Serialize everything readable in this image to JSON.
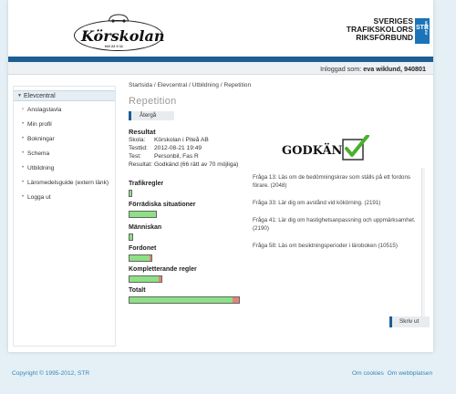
{
  "header": {
    "logo_text": "Körskolan",
    "logo_sub": "fell 22 0 11",
    "logo_icon": "car-icon",
    "str_lines": [
      "SVERIGES",
      "TRAFIKSKOLORS",
      "RIKSFÖRBUND"
    ],
    "str_badge": "STR",
    "str_badge_sub": "MEDLEM"
  },
  "userbar": {
    "label": "Inloggad som:",
    "user": "eva wiklund, 940801"
  },
  "sidebar": {
    "header": "Elevcentral",
    "items": [
      {
        "label": "Anslagstavla",
        "active": true
      },
      {
        "label": "Min profil"
      },
      {
        "label": "Bokningar"
      },
      {
        "label": "Schema"
      },
      {
        "label": "Utbildning"
      },
      {
        "label": "Läromedelsguide (extern länk)"
      },
      {
        "label": "Logga ut"
      }
    ]
  },
  "main": {
    "breadcrumb": "Startsida / Elevcentral / Utbildning / Repetition",
    "title": "Repetition",
    "back_label": "Återgå",
    "result": {
      "heading": "Resultat",
      "rows": [
        {
          "key": "Skola:",
          "value": "Körskolan i Piteå AB"
        },
        {
          "key": "Testtid:",
          "value": "2012-08-21 19:49"
        },
        {
          "key": "Test:",
          "value": "Personbil, Fas R"
        },
        {
          "key": "Resultat:",
          "value": "Godkänd (66 rätt av 70 möjliga)"
        }
      ]
    },
    "verdict": "GODKÄND",
    "verdict_icon": "checkmark-icon",
    "categories": [
      {
        "label": "Trafikregler",
        "correct_frac": 1.0,
        "total_frac": 0.033
      },
      {
        "label": "Förrädiska situationer",
        "correct_frac": 1.0,
        "total_frac": 0.25
      },
      {
        "label": "Människan",
        "correct_frac": 1.0,
        "total_frac": 0.043
      },
      {
        "label": "Fordonet",
        "correct_frac": 0.92,
        "total_frac": 0.212
      },
      {
        "label": "Kompletterande regler",
        "correct_frac": 0.92,
        "total_frac": 0.3
      },
      {
        "label": "Totalt",
        "correct_frac": 0.943,
        "total_frac": 1.0
      }
    ],
    "feedback": [
      "Fråga 13: Läs om de bedömningskrav som ställs på ett fordons förare. (2048)",
      "Fråga 33: Lär dig om avstånd vid kökörning. (2191)",
      "Fråga 41: Lär dig om hastighetsanpassning och uppmärksamhet. (2190)",
      "Fråga 58: Läs om besiktningsperioder i läroboken (10515)"
    ],
    "print_label": "Skriv ut"
  },
  "footer": {
    "copyright": "Copyright © 1995-2012, STR",
    "links": [
      "Om cookies",
      "Om webbplatsen"
    ]
  },
  "colors": {
    "accent": "#1d5e95",
    "bar_correct": "#8de085",
    "bar_wrong": "#e38379",
    "check": "#4caf2e"
  }
}
